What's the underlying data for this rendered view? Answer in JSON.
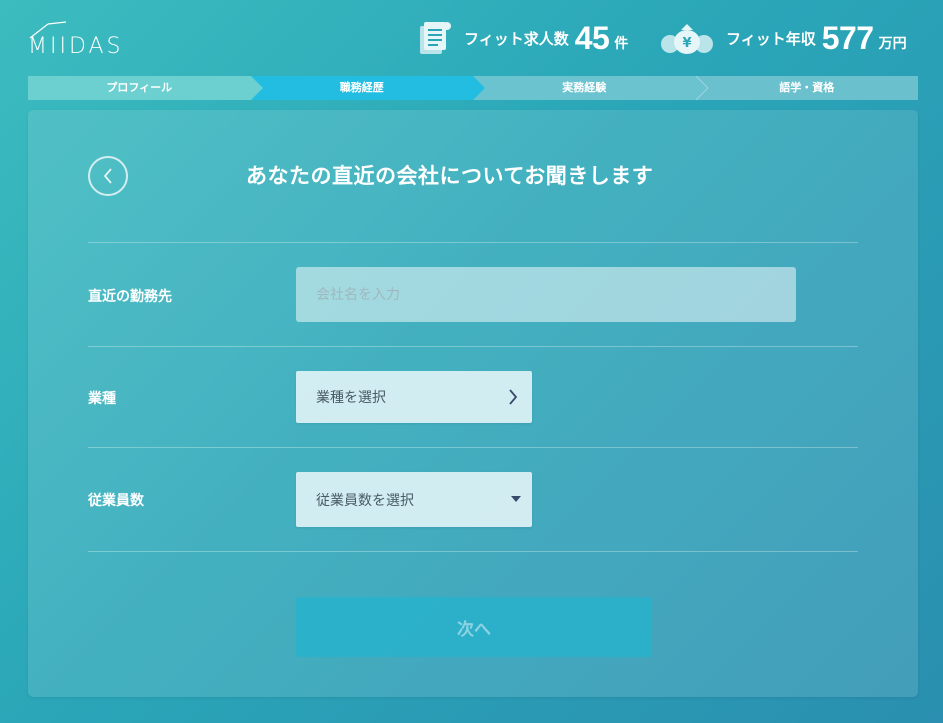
{
  "header": {
    "logo": "MIIDAS",
    "fit_jobs": {
      "label": "フィット求人数",
      "value": "45",
      "unit": "件",
      "icon": "document-icon"
    },
    "fit_salary": {
      "label": "フィット年収",
      "value": "577",
      "unit": "万円",
      "icon": "money-bag-icon"
    }
  },
  "steps": [
    {
      "label": "プロフィール",
      "state": "done"
    },
    {
      "label": "職務経歴",
      "state": "active"
    },
    {
      "label": "実務経験",
      "state": "todo"
    },
    {
      "label": "語学・資格",
      "state": "todo"
    }
  ],
  "form": {
    "title": "あなたの直近の会社についてお聞きします",
    "company": {
      "label": "直近の勤務先",
      "placeholder": "会社名を入力"
    },
    "industry": {
      "label": "業種",
      "value": "業種を選択"
    },
    "employees": {
      "label": "従業員数",
      "value": "従業員数を選択"
    },
    "next_label": "次へ"
  }
}
